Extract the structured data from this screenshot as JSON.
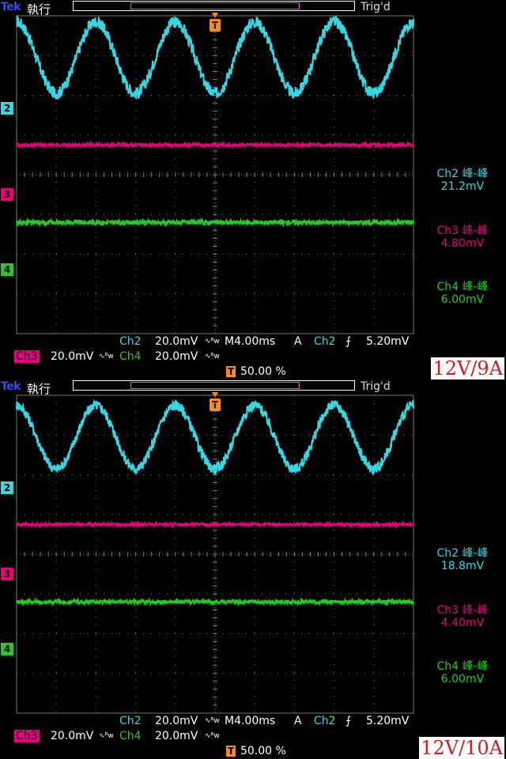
{
  "colors": {
    "ch2": "#36d6e3",
    "ch3": "#e6007e",
    "ch4": "#22cc22",
    "trigger": "#ff8c1a",
    "grid": "#7a7a7a",
    "caption": "#d01c1c"
  },
  "panels": [
    {
      "brand": "Tek",
      "run_state": "執行",
      "trig_state": "Trig'd",
      "trig_marker": "T",
      "channel_markers": [
        "2",
        "3",
        "4"
      ],
      "measurements": [
        {
          "label": "Ch2 峰-峰",
          "value": "21.2mV"
        },
        {
          "label": "Ch3 峰-峰",
          "value": "4.80mV"
        },
        {
          "label": "Ch4 峰-峰",
          "value": "6.00mV"
        }
      ],
      "status": {
        "ch2_name": "Ch2",
        "ch2_scale": "20.0mV",
        "timebase": "M4.00ms",
        "acq_mode": "A",
        "trig_source": "Ch2",
        "trig_level": "5.20mV",
        "ch3_name": "Ch3",
        "ch3_scale": "20.0mV",
        "ch4_name": "Ch4",
        "ch4_scale": "20.0mV",
        "trig_pos_marker": "T",
        "trig_pos": "50.00 %"
      },
      "caption": "12V/9A"
    },
    {
      "brand": "Tek",
      "run_state": "執行",
      "trig_state": "Trig'd",
      "trig_marker": "T",
      "channel_markers": [
        "2",
        "3",
        "4"
      ],
      "measurements": [
        {
          "label": "Ch2 峰-峰",
          "value": "18.8mV"
        },
        {
          "label": "Ch3 峰-峰",
          "value": "4.40mV"
        },
        {
          "label": "Ch4 峰-峰",
          "value": "6.00mV"
        }
      ],
      "status": {
        "ch2_name": "Ch2",
        "ch2_scale": "20.0mV",
        "timebase": "M4.00ms",
        "acq_mode": "A",
        "trig_source": "Ch2",
        "trig_level": "5.20mV",
        "ch3_name": "Ch3",
        "ch3_scale": "20.0mV",
        "ch4_name": "Ch4",
        "ch4_scale": "20.0mV",
        "trig_pos_marker": "T",
        "trig_pos": "50.00 %"
      },
      "caption": "12V/10A"
    }
  ],
  "chart_data": [
    {
      "type": "line",
      "xlim": [
        0,
        40
      ],
      "ylim": [
        -4,
        4
      ],
      "series": [
        {
          "name": "Ch2",
          "kind": "sine",
          "period": 8.0,
          "amplitude": 0.9,
          "offset": 2.95,
          "noise": 0.15
        },
        {
          "name": "Ch3",
          "kind": "flat",
          "offset": 0.75,
          "noise": 0.04
        },
        {
          "name": "Ch4",
          "kind": "flat",
          "offset": -1.2,
          "noise": 0.06
        }
      ]
    },
    {
      "type": "line",
      "xlim": [
        0,
        40
      ],
      "ylim": [
        -4,
        4
      ],
      "series": [
        {
          "name": "Ch2",
          "kind": "sine",
          "period": 8.0,
          "amplitude": 0.8,
          "offset": 2.95,
          "noise": 0.13
        },
        {
          "name": "Ch3",
          "kind": "flat",
          "offset": 0.75,
          "noise": 0.035
        },
        {
          "name": "Ch4",
          "kind": "flat",
          "offset": -1.2,
          "noise": 0.05
        }
      ]
    }
  ]
}
